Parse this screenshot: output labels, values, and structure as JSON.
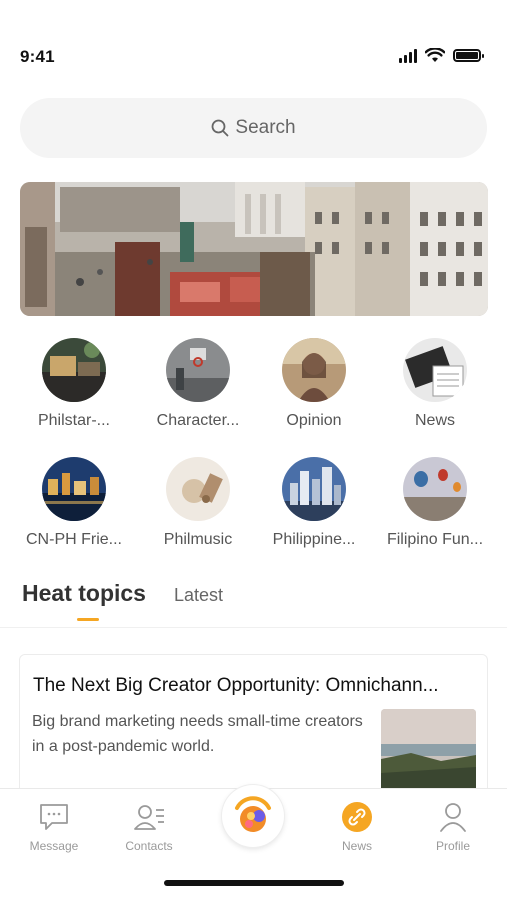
{
  "status_bar": {
    "time": "9:41"
  },
  "search": {
    "label": "Search"
  },
  "categories": [
    {
      "label": "Philstar-..."
    },
    {
      "label": "Character..."
    },
    {
      "label": "Opinion"
    },
    {
      "label": "News"
    },
    {
      "label": "CN-PH Frie..."
    },
    {
      "label": "Philmusic"
    },
    {
      "label": "Philippine..."
    },
    {
      "label": "Filipino Fun..."
    }
  ],
  "feed_tabs": {
    "active": "Heat topics",
    "inactive": "Latest"
  },
  "article": {
    "title": "The Next Big Creator Opportunity: Omnichann...",
    "description": " Big brand marketing needs small-time creators in a post-pandemic world."
  },
  "bottom_nav": [
    {
      "label": "Message",
      "icon": "message-icon"
    },
    {
      "label": "Contacts",
      "icon": "contacts-icon"
    },
    {
      "label": "News",
      "icon": "news-icon"
    },
    {
      "label": "Profile",
      "icon": "profile-icon"
    }
  ],
  "colors": {
    "accent": "#f5a623",
    "search_bg": "#f4f4f4",
    "muted_text": "#9a9a9a"
  }
}
